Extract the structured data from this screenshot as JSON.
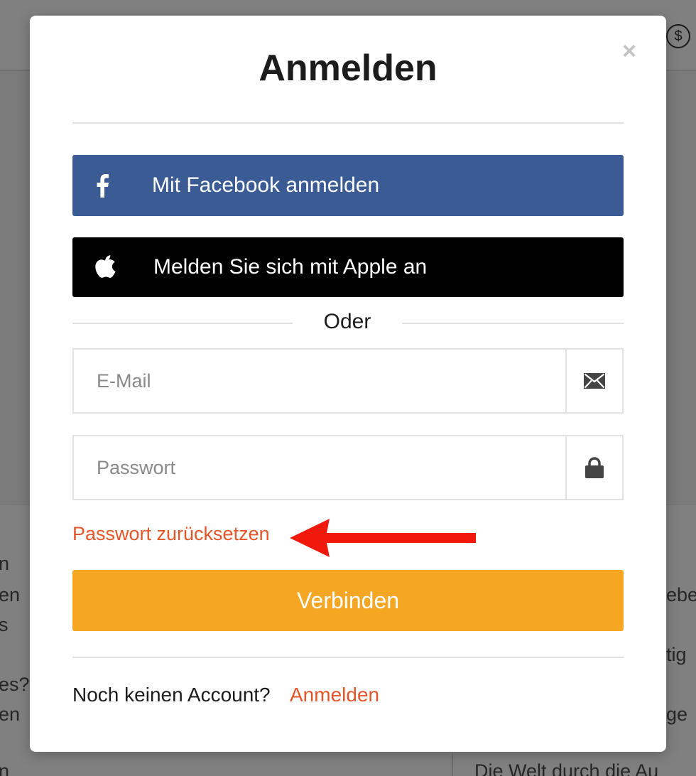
{
  "background": {
    "currency_icon": "dollar-circle-icon",
    "left_fragments": [
      "n",
      "en",
      "s",
      "es?",
      "en",
      "n"
    ],
    "right_fragments": [
      "ebe",
      "tig",
      "ge",
      "Die Welt durch die Au"
    ]
  },
  "modal": {
    "title": "Anmelden",
    "close_icon": "close-icon",
    "facebook_button": {
      "label": "Mit Facebook anmelden",
      "icon": "facebook-icon",
      "color": "#3b5b94"
    },
    "apple_button": {
      "label": "Melden Sie sich mit Apple an",
      "icon": "apple-icon",
      "color": "#000000"
    },
    "divider_text": "Oder",
    "email_field": {
      "placeholder": "E-Mail",
      "value": "",
      "icon": "envelope-icon"
    },
    "password_field": {
      "placeholder": "Passwort",
      "value": "",
      "icon": "lock-icon"
    },
    "reset_link": "Passwort zurücksetzen",
    "annotation": {
      "icon": "red-arrow-icon",
      "color": "#f0190c"
    },
    "submit_button": {
      "label": "Verbinden",
      "color": "#f5a623"
    },
    "footer": {
      "text": "Noch keinen Account?",
      "link": "Anmelden"
    },
    "accent_color": "#e4562a"
  }
}
